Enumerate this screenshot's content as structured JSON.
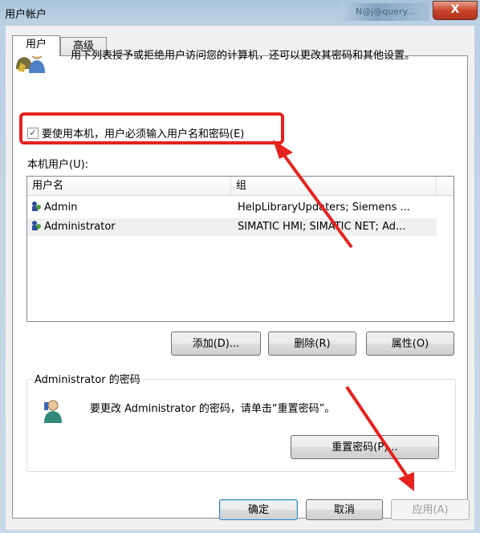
{
  "window": {
    "title": "用户帐户",
    "background_title": "N@j@query...",
    "close_symbol": "X"
  },
  "tabs": [
    {
      "label": "用户"
    },
    {
      "label": "高级"
    }
  ],
  "intro": {
    "text": "用下列表授予或拒绝用户访问您的计算机，还可以更改其密码和其他设置。"
  },
  "require_login": {
    "label": "要使用本机，用户必须输入用户名和密码(E)",
    "checked": true,
    "check_symbol": "✓"
  },
  "users": {
    "label": "本机用户(U):",
    "columns": [
      "用户名",
      "组"
    ],
    "rows": [
      {
        "name": "Admin",
        "group": "HelpLibraryUpdaters; Siemens ..."
      },
      {
        "name": "Administrator",
        "group": "SIMATIC HMI; SIMATIC NET; Ad..."
      }
    ]
  },
  "buttons": {
    "add": "添加(D)...",
    "delete": "删除(R)",
    "properties": "属性(O)"
  },
  "password": {
    "group_title": "Administrator 的密码",
    "text": "要更改 Administrator 的密码，请单击“重置密码”。",
    "reset_button": "重置密码(P)..."
  },
  "footer": {
    "ok": "确定",
    "cancel": "取消",
    "apply": "应用(A)"
  },
  "colors": {
    "highlight": "#e5221d",
    "arrow": "#e5221d"
  }
}
